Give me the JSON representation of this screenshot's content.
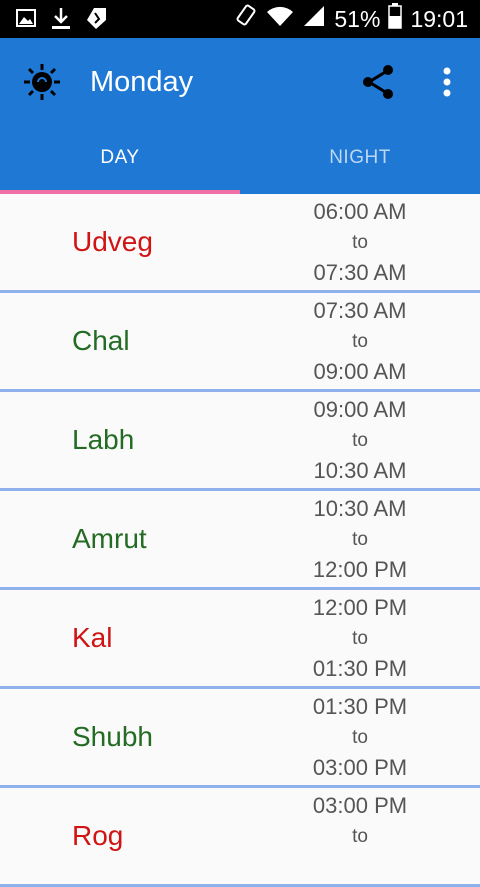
{
  "status_bar": {
    "battery": "51%",
    "time": "19:01",
    "icons": [
      "gallery-icon",
      "download-icon",
      "tag-icon",
      "rotate-icon",
      "wifi-icon",
      "signal-icon",
      "battery-icon"
    ]
  },
  "app_bar": {
    "title": "Monday",
    "icons": [
      "sun-icon",
      "share-icon",
      "more-vert-icon"
    ],
    "accent": "#1e78d4"
  },
  "tabs": [
    {
      "label": "DAY",
      "selected": true
    },
    {
      "label": "NIGHT",
      "selected": false
    }
  ],
  "colors": {
    "inauspicious": "#d01313",
    "auspicious": "#246b24",
    "indicator": "#ef6fa7",
    "divider": "#8fb1ec"
  },
  "rows": [
    {
      "name": "Udveg",
      "start": "06:00 AM",
      "sep": "to",
      "end": "07:30 AM",
      "type": "bad"
    },
    {
      "name": "Chal",
      "start": "07:30 AM",
      "sep": "to",
      "end": "09:00 AM",
      "type": "good"
    },
    {
      "name": "Labh",
      "start": "09:00 AM",
      "sep": "to",
      "end": "10:30 AM",
      "type": "good"
    },
    {
      "name": "Amrut",
      "start": "10:30 AM",
      "sep": "to",
      "end": "12:00 PM",
      "type": "good"
    },
    {
      "name": "Kal",
      "start": "12:00 PM",
      "sep": "to",
      "end": "01:30 PM",
      "type": "bad"
    },
    {
      "name": "Shubh",
      "start": "01:30 PM",
      "sep": "to",
      "end": "03:00 PM",
      "type": "good"
    },
    {
      "name": "Rog",
      "start": "03:00 PM",
      "sep": "to",
      "end": "",
      "type": "bad"
    }
  ]
}
